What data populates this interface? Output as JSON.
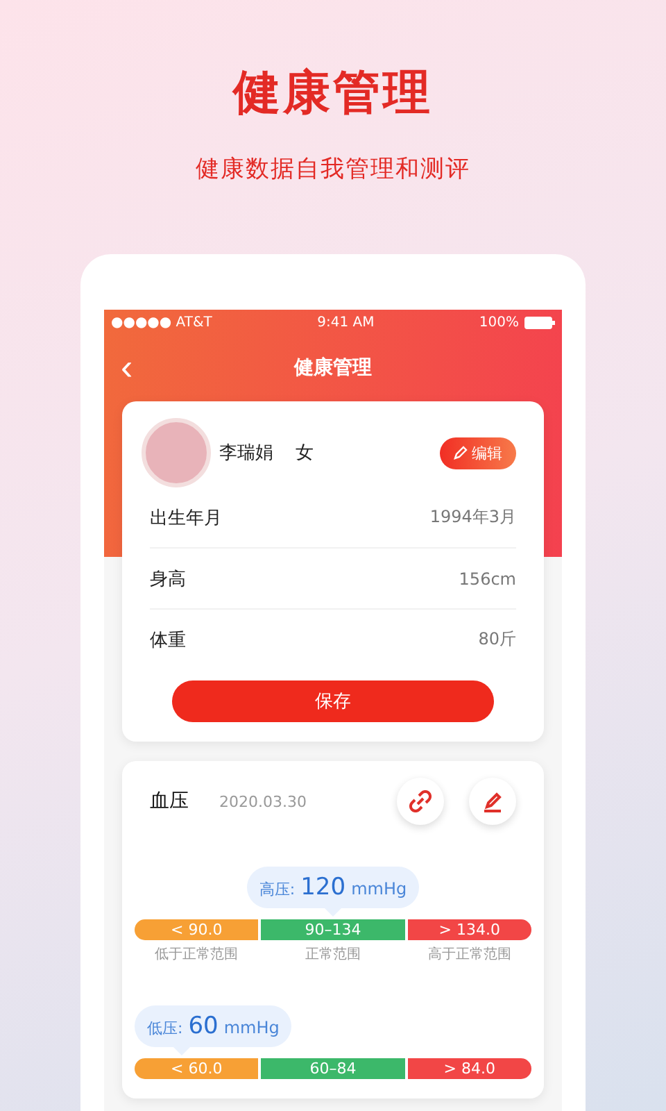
{
  "promo": {
    "title": "健康管理",
    "subtitle": "健康数据自我管理和测评"
  },
  "status_bar": {
    "carrier": "●●●●● AT&T",
    "time": "9:41 AM",
    "battery": "100%"
  },
  "nav": {
    "back": "‹",
    "title": "健康管理"
  },
  "profile": {
    "name": "李瑞娟",
    "gender": "女",
    "edit": "编辑",
    "fields": [
      {
        "label": "出生年月",
        "value": "1994年3月"
      },
      {
        "label": "身高",
        "value": "156cm"
      },
      {
        "label": "体重",
        "value": "80斤"
      }
    ],
    "save": "保存"
  },
  "blood_pressure": {
    "title": "血压",
    "date": "2020.03.30",
    "gauges": [
      {
        "label": "高压:",
        "value": "120",
        "unit": "mmHg",
        "segments": [
          {
            "range": "< 90.0",
            "caption": "低于正常范围",
            "color": "#f7a035"
          },
          {
            "range": "90–134",
            "caption": "正常范围",
            "color": "#3cb86a"
          },
          {
            "range": "> 134.0",
            "caption": "高于正常范围",
            "color": "#f24646"
          }
        ]
      },
      {
        "label": "低压:",
        "value": "60",
        "unit": "mmHg",
        "segments": [
          {
            "range": "< 60.0",
            "color": "#f7a035"
          },
          {
            "range": "60–84",
            "color": "#3cb86a"
          },
          {
            "range": "> 84.0",
            "color": "#f24646"
          }
        ]
      }
    ]
  }
}
